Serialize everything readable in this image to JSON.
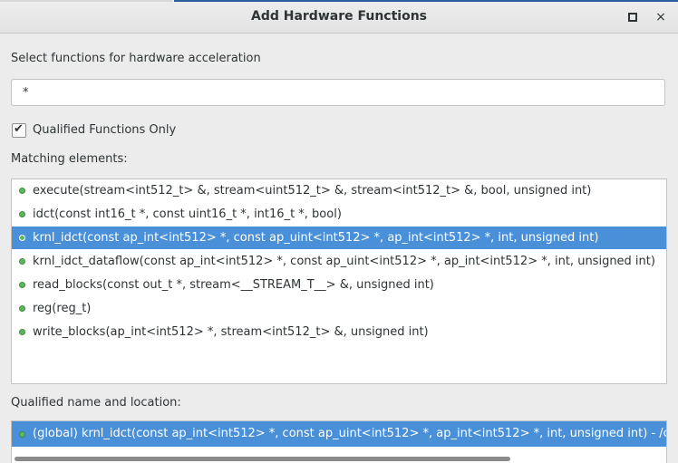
{
  "window": {
    "title": "Add Hardware Functions",
    "close_glyph": "×"
  },
  "search": {
    "label": "Select functions for hardware acceleration",
    "value": "*"
  },
  "filter": {
    "checkbox_label": "Qualified Functions Only",
    "checked": true
  },
  "matching": {
    "label": "Matching elements:",
    "items": [
      {
        "text": "execute(stream<int512_t> &, stream<uint512_t> &, stream<int512_t> &, bool, unsigned int)",
        "selected": false
      },
      {
        "text": "idct(const int16_t *, const uint16_t *, int16_t *, bool)",
        "selected": false
      },
      {
        "text": "krnl_idct(const ap_int<int512> *, const ap_uint<int512> *, ap_int<int512> *, int, unsigned int)",
        "selected": true
      },
      {
        "text": "krnl_idct_dataflow(const ap_int<int512> *, const ap_uint<int512> *, ap_int<int512> *, int, unsigned int)",
        "selected": false
      },
      {
        "text": "read_blocks(const out_t *, stream<__STREAM_T__> &, unsigned int)",
        "selected": false
      },
      {
        "text": "reg(reg_t)",
        "selected": false
      },
      {
        "text": "write_blocks(ap_int<int512> *, stream<int512_t> &, unsigned int)",
        "selected": false
      }
    ]
  },
  "qualified": {
    "label": "Qualified name and location:",
    "value": "(global) krnl_idct(const ap_int<int512> *, const ap_uint<int512> *, ap_int<int512> *, int, unsigned int) - /optin"
  },
  "colors": {
    "selection": "#4a90d9",
    "status_dot": "#5cb85c",
    "titlebar_accent": "#2a5d9f"
  },
  "icons": {
    "maximize": "maximize-icon",
    "close": "close-icon",
    "item": "green-dot-icon"
  }
}
